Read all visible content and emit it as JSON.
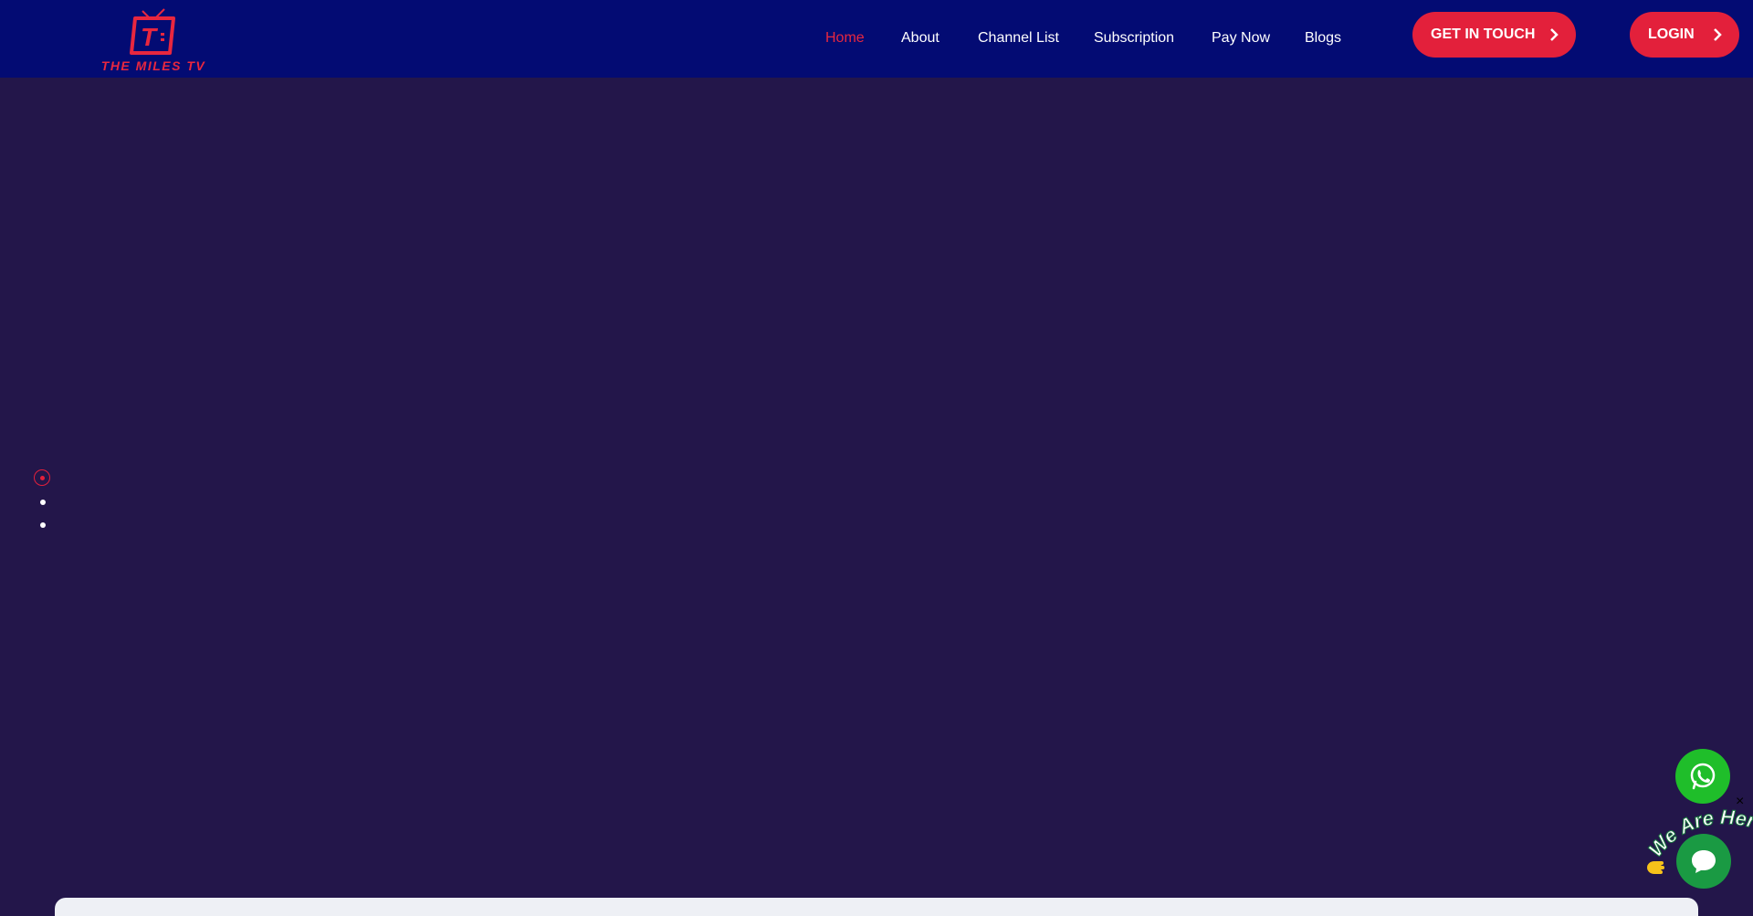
{
  "brand": {
    "name": "THE MILES TV",
    "color": "#e8273f"
  },
  "nav": {
    "items": [
      {
        "label": "Home",
        "active": true
      },
      {
        "label": "About"
      },
      {
        "label": "Channel List"
      },
      {
        "label": "Subscription"
      },
      {
        "label": "Pay Now"
      },
      {
        "label": "Blogs"
      }
    ]
  },
  "buttons": {
    "get_in_touch": "GET IN TOUCH",
    "login": "LOGIN"
  },
  "slider": {
    "dots": 3,
    "active_index": 0
  },
  "widgets": {
    "whatsapp_icon": "whatsapp-icon",
    "chat_icon": "chat-bubble-icon",
    "we_are_here": "We Are Here!",
    "close": "×"
  },
  "colors": {
    "header_bg": "#030b73",
    "hero_bg": "#23164a",
    "accent": "#e3203b",
    "whatsapp": "#1fbe2a",
    "chat": "#1a9a43"
  }
}
